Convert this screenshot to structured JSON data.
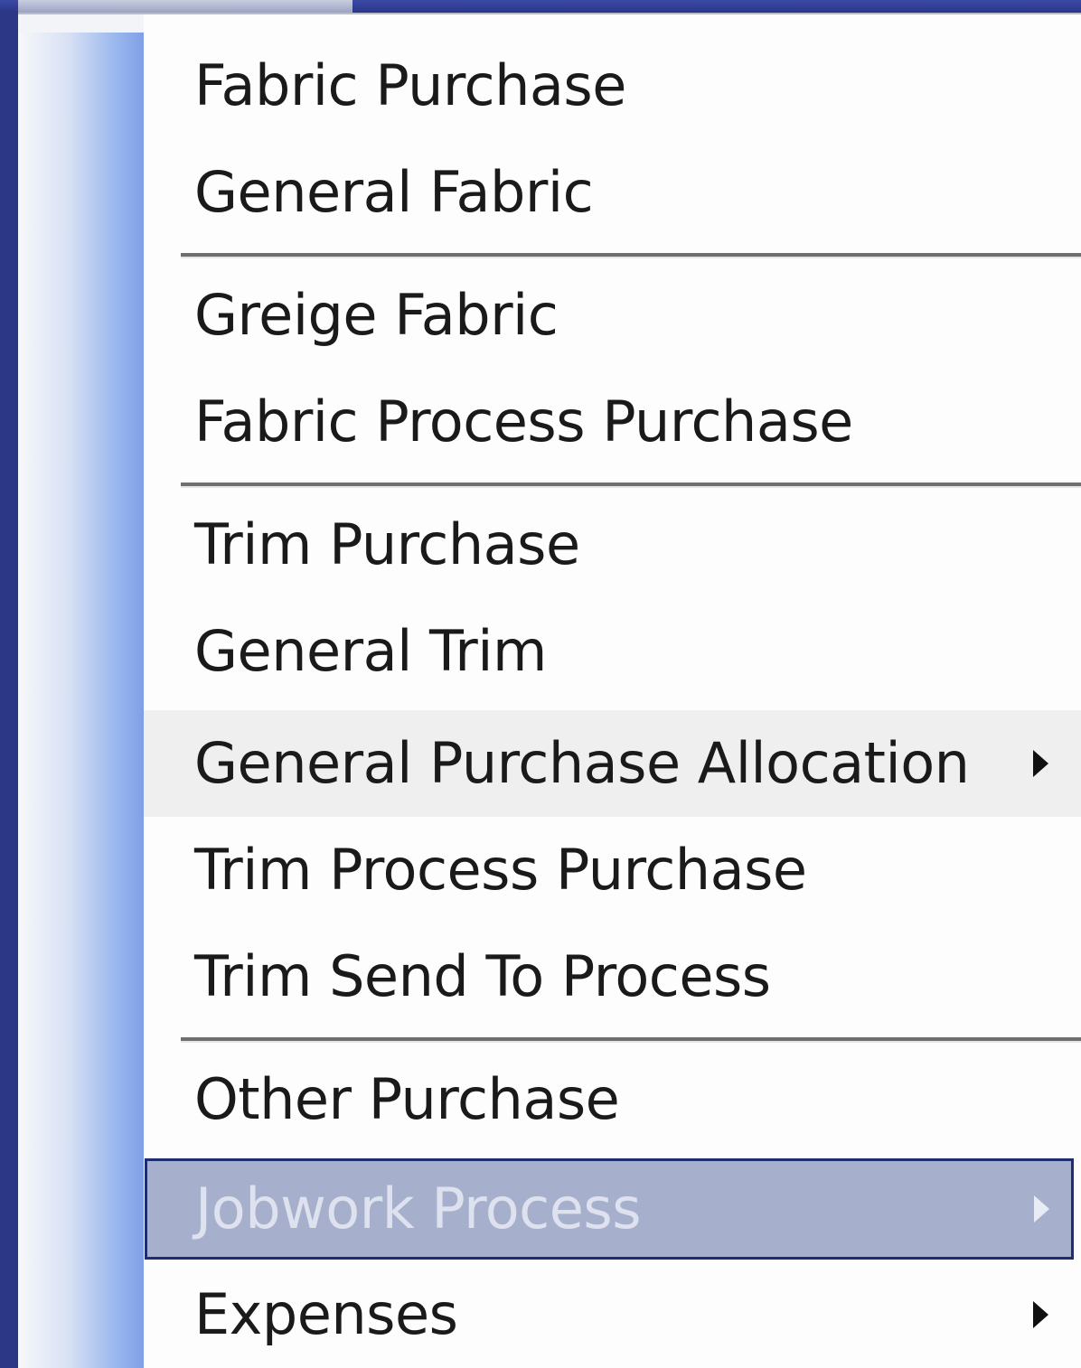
{
  "menu": {
    "items": [
      {
        "label": "Fabric Purchase",
        "has_submenu": false
      },
      {
        "label": "General Fabric",
        "has_submenu": false
      },
      {
        "label": "Greige Fabric",
        "has_submenu": false
      },
      {
        "label": "Fabric Process Purchase",
        "has_submenu": false
      },
      {
        "label": "Trim Purchase",
        "has_submenu": false
      },
      {
        "label": "General Trim",
        "has_submenu": false
      },
      {
        "label": "General Purchase Allocation",
        "has_submenu": true,
        "icon": "submenu-arrow-icon"
      },
      {
        "label": "Trim Process Purchase",
        "has_submenu": false
      },
      {
        "label": "Trim Send To Process",
        "has_submenu": false
      },
      {
        "label": "Other Purchase",
        "has_submenu": false
      },
      {
        "label": "Jobwork Process",
        "has_submenu": true,
        "state": "selected",
        "icon": "submenu-arrow-icon"
      },
      {
        "label": "Expenses",
        "has_submenu": true,
        "icon": "submenu-arrow-icon"
      }
    ]
  },
  "colors": {
    "background": "#2e3a86",
    "menu_bg": "#fdfdfd",
    "hover_bg": "#efefef",
    "selected_bg": "#a6b0cd",
    "selected_border": "#1e2c72",
    "gutter_accent": "#7f9fe6"
  }
}
